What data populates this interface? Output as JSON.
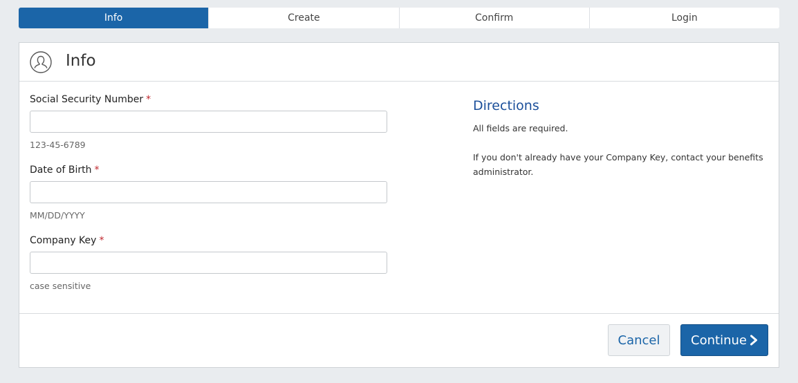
{
  "stepper": {
    "steps": [
      {
        "label": "Info",
        "active": true
      },
      {
        "label": "Create",
        "active": false
      },
      {
        "label": "Confirm",
        "active": false
      },
      {
        "label": "Login",
        "active": false
      }
    ]
  },
  "header": {
    "icon": "user-circle-icon",
    "title": "Info"
  },
  "form": {
    "required_marker": "*",
    "fields": [
      {
        "label": "Social Security Number",
        "value": "",
        "hint": "123-45-6789"
      },
      {
        "label": "Date of Birth",
        "value": "",
        "hint": "MM/DD/YYYY"
      },
      {
        "label": "Company Key",
        "value": "",
        "hint": "case sensitive"
      }
    ]
  },
  "directions": {
    "title": "Directions",
    "line1": "All fields are required.",
    "line2": "If you don't already have your Company Key, contact your benefits administrator."
  },
  "footer": {
    "cancel_label": "Cancel",
    "continue_label": "Continue",
    "continue_icon": "chevron-right-icon"
  },
  "colors": {
    "primary": "#1b65a8",
    "required": "#c0272d",
    "directions_title": "#1b4f9a",
    "background": "#e9ecef"
  }
}
